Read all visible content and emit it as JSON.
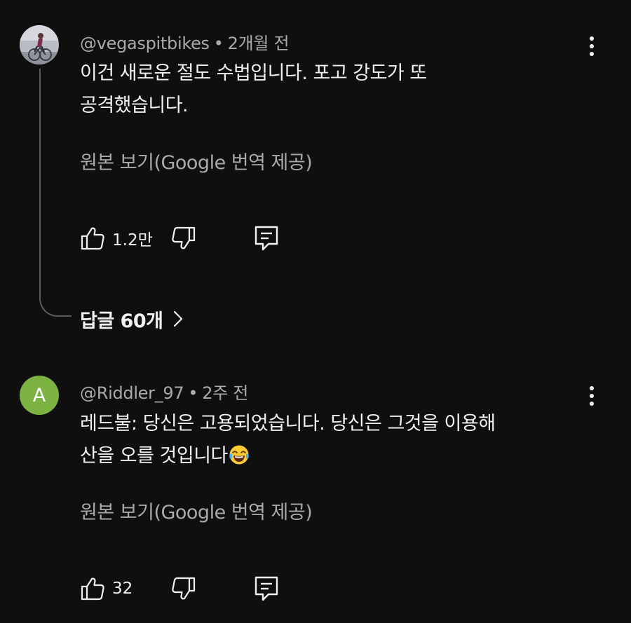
{
  "comments": [
    {
      "author": "@vegaspitbikes",
      "separator": "•",
      "time": "2개월 전",
      "text_line1": "이건 새로운 절도 수법입니다. 포고 강도가 또",
      "text_line2": "공격했습니다.",
      "translate_label": "원본 보기(Google 번역 제공)",
      "like_count": "1.2만",
      "replies_label": "답글 60개",
      "avatar_icon": "bike-rider-photo"
    },
    {
      "author": "@Riddler_97",
      "separator": "•",
      "time": "2주 전",
      "avatar_letter": "A",
      "avatar_color": "#7cb342",
      "text_line1": "레드불: 당신은 고용되었습니다. 당신은 그것을 이용해",
      "text_line2": "산을 오를 것입니다",
      "emoji": "face-with-tears-of-joy",
      "translate_label": "원본 보기(Google 번역 제공)",
      "like_count": "32"
    }
  ],
  "icons": {
    "like": "thumb-up-icon",
    "dislike": "thumb-down-icon",
    "reply": "reply-comment-icon",
    "more": "more-vert-icon",
    "chevron": "chevron-right-icon"
  },
  "colors": {
    "background": "#0f0f0f",
    "text": "#f1f1f1",
    "secondary": "#aaaaaa",
    "avatar_green": "#7cb342"
  }
}
